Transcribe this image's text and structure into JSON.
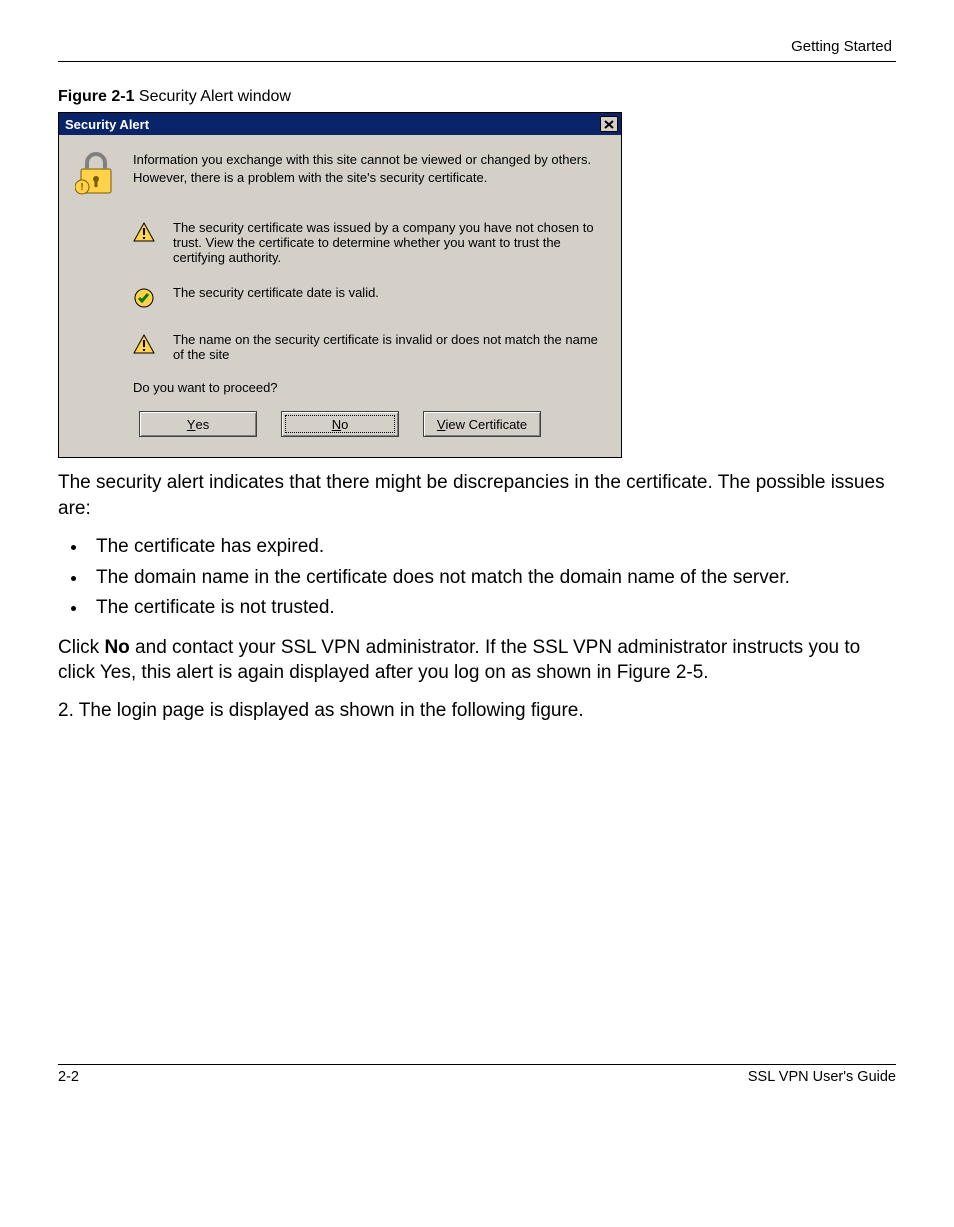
{
  "header": {
    "running_title": "Getting Started"
  },
  "caption": {
    "bold": "Figure 2-1",
    "rest": "  Security Alert window"
  },
  "dialog": {
    "title": "Security Alert",
    "intro": "Information you exchange with this site cannot be viewed or changed by others. However, there is a problem with the site's security certificate.",
    "items": [
      "The security certificate was issued by a company you have not chosen to trust. View the certificate to determine whether you want to trust the certifying authority.",
      "The security certificate date is valid.",
      "The name on the security certificate is invalid or does not match the name of the site"
    ],
    "proceed": "Do you want to proceed?",
    "buttons": {
      "yes": "Yes",
      "no": "No",
      "view": "View Certificate"
    }
  },
  "para1": "The security alert indicates that there might be discrepancies in the certificate. The possible issues are:",
  "bullets": [
    "The certificate has expired.",
    "The domain name in the certificate does not match the domain name of the server.",
    "The certificate is not trusted."
  ],
  "para2_a": "Click ",
  "para2_bold": "No",
  "para2_b": " and contact your SSL VPN administrator. If the SSL VPN administrator instructs you to click Yes, this alert is again displayed after you log on as shown in Figure 2-5.",
  "step2": "2.  The login page is displayed as shown in the following figure.",
  "footer": {
    "left": "2-2",
    "right": "SSL VPN User's Guide"
  }
}
